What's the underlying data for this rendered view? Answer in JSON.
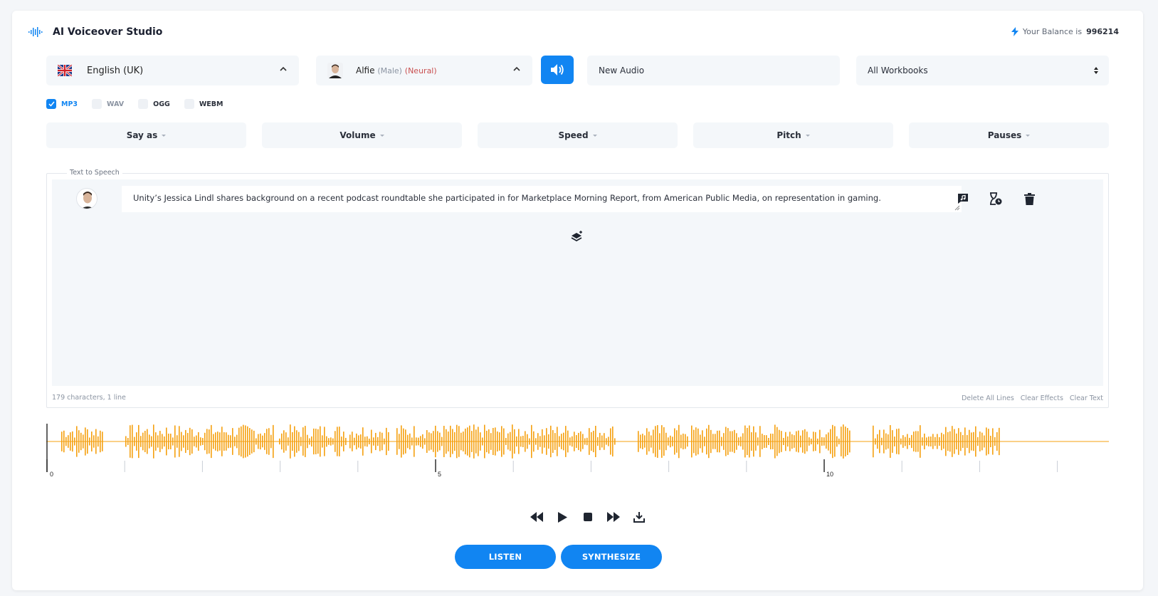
{
  "app": {
    "title": "AI Voiceover Studio"
  },
  "balance": {
    "prefix": "Your Balance is",
    "amount": "996214"
  },
  "language": {
    "label": "English (UK)",
    "flag": "uk-flag-icon"
  },
  "voice": {
    "name": "Alfie",
    "gender": "(Male)",
    "type": "(Neural)"
  },
  "audio_name": {
    "value": "New Audio"
  },
  "workbook_select": {
    "value": "All Workbooks"
  },
  "formats": [
    {
      "label": "MP3",
      "checked": true
    },
    {
      "label": "WAV",
      "checked": false
    },
    {
      "label": "OGG",
      "checked": false
    },
    {
      "label": "WEBM",
      "checked": false
    }
  ],
  "effects": [
    "Say as",
    "Volume",
    "Speed",
    "Pitch",
    "Pauses"
  ],
  "tts": {
    "legend": "Text to Speech",
    "line_text": "Unity’s Jessica Lindl shares background on a recent podcast roundtable she participated in for Marketplace Morning Report, from American Public Media, on representation in gaming.",
    "char_count": "179 characters, 1 line",
    "links": [
      "Delete All Lines",
      "Clear Effects",
      "Clear Text"
    ]
  },
  "timeline": {
    "tick_labels": [
      "0",
      "5",
      "10"
    ],
    "wave_color": "#f5a00f"
  },
  "buttons": {
    "listen": "LISTEN",
    "synthesize": "SYNTHESIZE"
  },
  "colors": {
    "accent": "#1185f2",
    "neural": "#c95050"
  }
}
